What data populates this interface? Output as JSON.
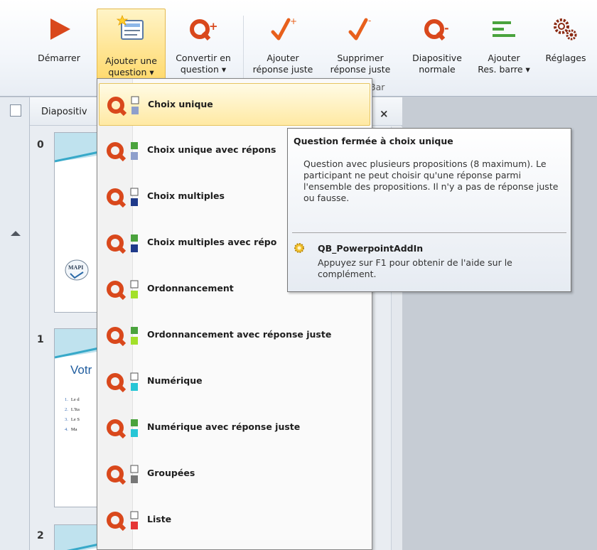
{
  "ribbon": {
    "buttons": [
      {
        "id": "demarrer",
        "line1": "Démarrer",
        "line2": "",
        "icon": "play-icon"
      },
      {
        "id": "ajouter-question",
        "line1": "Ajouter une",
        "line2": "question ▾",
        "icon": "add-question-icon"
      },
      {
        "id": "convertir",
        "line1": "Convertir en",
        "line2": "question ▾",
        "icon": "convert-question-icon"
      },
      {
        "id": "ajouter-reponse",
        "line1": "Ajouter",
        "line2": "réponse juste",
        "icon": "add-correct-answer-icon"
      },
      {
        "id": "supprimer-reponse",
        "line1": "Supprimer",
        "line2": "réponse juste",
        "icon": "remove-correct-answer-icon"
      },
      {
        "id": "diapositive-normale",
        "line1": "Diapositive",
        "line2": "normale",
        "icon": "normal-slide-icon"
      },
      {
        "id": "ajouter-res-barre",
        "line1": "Ajouter",
        "line2": "Res. barre ▾",
        "icon": "results-bar-icon"
      },
      {
        "id": "reglages",
        "line1": "Réglages",
        "line2": "",
        "icon": "settings-gears-icon"
      }
    ],
    "group_label": "Bar"
  },
  "slides_panel": {
    "title": "Diapositiv",
    "close": "×",
    "slides": [
      {
        "number": "0"
      },
      {
        "number": "1",
        "title": "Votr",
        "lines": [
          {
            "n": "1.",
            "t": "Le d"
          },
          {
            "n": "2.",
            "t": "L'Ita"
          },
          {
            "n": "3.",
            "t": "Le S"
          },
          {
            "n": "4.",
            "t": "Ma"
          }
        ]
      },
      {
        "number": "2"
      }
    ],
    "logo_text": "MAPI"
  },
  "dropdown": {
    "items": [
      {
        "label": "Choix unique",
        "color": "#8e9fcc",
        "second": "empty",
        "highlighted": true
      },
      {
        "label": "Choix unique avec répons",
        "color": "#8e9fcc",
        "second": "#4aa33d"
      },
      {
        "label": "Choix multiples",
        "color": "#1f3a8a",
        "second": "empty"
      },
      {
        "label": "Choix multiples avec répo",
        "color": "#1f3a8a",
        "second": "#4aa33d"
      },
      {
        "label": "Ordonnancement",
        "color": "#a3e02a",
        "second": "empty"
      },
      {
        "label": "Ordonnancement avec réponse juste",
        "color": "#a3e02a",
        "second": "#4aa33d"
      },
      {
        "label": "Numérique",
        "color": "#27c6d6",
        "second": "empty"
      },
      {
        "label": "Numérique avec réponse juste",
        "color": "#27c6d6",
        "second": "#4aa33d"
      },
      {
        "label": "Groupées",
        "color": "#777777",
        "second": "empty"
      },
      {
        "label": "Liste",
        "color": "#e53535",
        "second": "empty"
      }
    ]
  },
  "tooltip": {
    "title": "Question fermée à choix unique",
    "body": "Question avec plusieurs propositions (8 maximum). Le participant ne peut choisir qu'une réponse parmi l'ensemble des propositions. Il n'y a pas de réponse juste ou fausse.",
    "addin_name": "QB_PowerpointAddIn",
    "help": "Appuyez sur F1 pour obtenir de l'aide sur le complément."
  },
  "colors": {
    "brand_orange": "#d9481c",
    "check_orange": "#e8601c",
    "bar_green": "#4aa33d",
    "highlight": "#ffe08a"
  }
}
